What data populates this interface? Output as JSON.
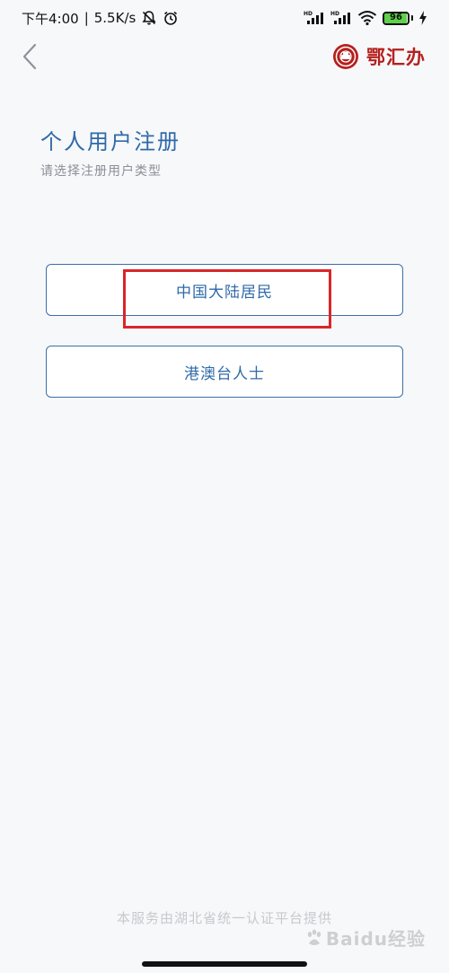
{
  "status_bar": {
    "time": "下午4:00",
    "net_speed": "5.5K/s",
    "separator": "|",
    "battery_level": "96",
    "battery_fraction": 0.96
  },
  "nav": {
    "brand_name": "鄂汇办"
  },
  "page": {
    "title": "个人用户注册",
    "subtitle": "请选择注册用户类型"
  },
  "options": [
    {
      "label": "中国大陆居民"
    },
    {
      "label": "港澳台人士"
    }
  ],
  "footer": {
    "text": "本服务由湖北省统一认证平台提供"
  },
  "watermark": {
    "text": "Baidu经验"
  },
  "colors": {
    "accent": "#2f6aa8",
    "brand": "#b5201e",
    "highlight": "#d9262b",
    "battery": "#5ed14a"
  }
}
